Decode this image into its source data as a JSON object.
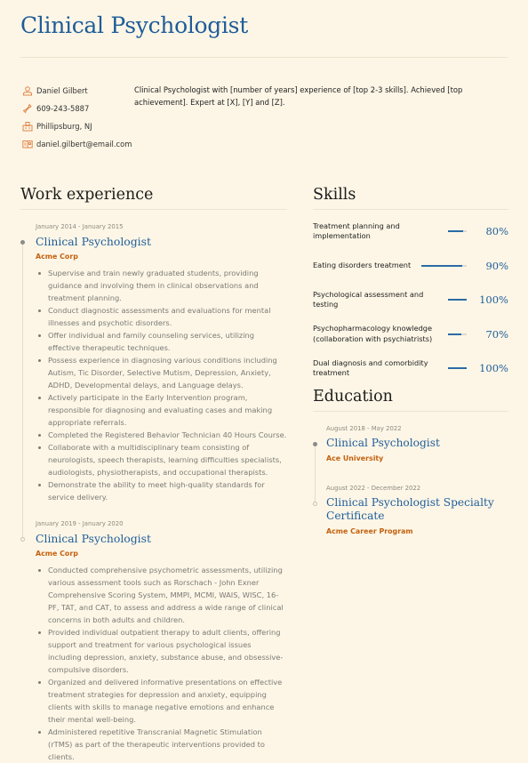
{
  "header": {
    "title": "Clinical Psychologist"
  },
  "contact": [
    {
      "icon": "person-icon",
      "text": "Daniel Gilbert"
    },
    {
      "icon": "phone-icon",
      "text": "609-243-5887"
    },
    {
      "icon": "location-icon",
      "text": "Phillipsburg, NJ"
    },
    {
      "icon": "email-icon",
      "text": "daniel.gilbert@email.com"
    }
  ],
  "summary": "Clinical Psychologist with [number of years] experience of [top 2-3 skills]. Achieved [top achievement]. Expert at [X], [Y] and [Z].",
  "colors": {
    "accent": "#1f5d99",
    "organization": "#c4610f",
    "icon": "#e0874a",
    "background": "#fdf6e6"
  },
  "work": {
    "heading": "Work experience",
    "entries": [
      {
        "date": "January 2014 - January 2015",
        "role": "Clinical Psychologist",
        "org": "Acme Corp",
        "bullets": [
          "Supervise and train newly graduated students, providing guidance and involving them in clinical observations and treatment planning.",
          "Conduct diagnostic assessments and evaluations for mental illnesses and psychotic disorders.",
          "Offer individual and family counseling services, utilizing effective therapeutic techniques.",
          "Possess experience in diagnosing various conditions including Autism, Tic Disorder, Selective Mutism, Depression, Anxiety, ADHD, Developmental delays, and Language delays.",
          "Actively participate in the Early Intervention program, responsible for diagnosing and evaluating cases and making appropriate referrals.",
          "Completed the Registered Behavior Technician 40 Hours Course.",
          "Collaborate with a multidisciplinary team consisting of neurologists, speech therapists, learning difficulties specialists, audiologists, physiotherapists, and occupational therapists.",
          "Demonstrate the ability to meet high-quality standards for service delivery."
        ]
      },
      {
        "date": "January 2019 - January 2020",
        "role": "Clinical Psychologist",
        "org": "Acme Corp",
        "bullets": [
          "Conducted comprehensive psychometric assessments, utilizing various assessment tools such as Rorschach - John Exner Comprehensive Scoring System, MMPI, MCMI, WAIS, WISC, 16-PF, TAT, and CAT, to assess and address a wide range of clinical concerns in both adults and children.",
          "Provided individual outpatient therapy to adult clients, offering support and treatment for various psychological issues including depression, anxiety, substance abuse, and obsessive-compulsive disorders.",
          "Organized and delivered informative presentations on effective treatment strategies for depression and anxiety, equipping clients with skills to manage negative emotions and enhance their mental well-being.",
          "Administered repetitive Transcranial Magnetic Stimulation (rTMS) as part of the therapeutic interventions provided to clients."
        ]
      }
    ]
  },
  "skills": {
    "heading": "Skills",
    "items": [
      {
        "label": "Treatment planning and implementation",
        "level": 0.8,
        "percent": "80%"
      },
      {
        "label": "Eating disorders treatment",
        "level": 0.9,
        "percent": "90%"
      },
      {
        "label": "Psychological assessment and testing",
        "level": 1.0,
        "percent": "100%"
      },
      {
        "label": "Psychopharmacology knowledge (collaboration with psychiatrists)",
        "level": 0.7,
        "percent": "70%"
      },
      {
        "label": "Dual diagnosis and comorbidity treatment",
        "level": 1.0,
        "percent": "100%"
      }
    ]
  },
  "education": {
    "heading": "Education",
    "entries": [
      {
        "date": "August 2018 - May 2022",
        "role": "Clinical Psychologist",
        "org": "Ace University"
      },
      {
        "date": "August 2022 - December 2022",
        "role": "Clinical Psychologist Specialty Certificate",
        "org": "Acme Career Program"
      }
    ]
  }
}
